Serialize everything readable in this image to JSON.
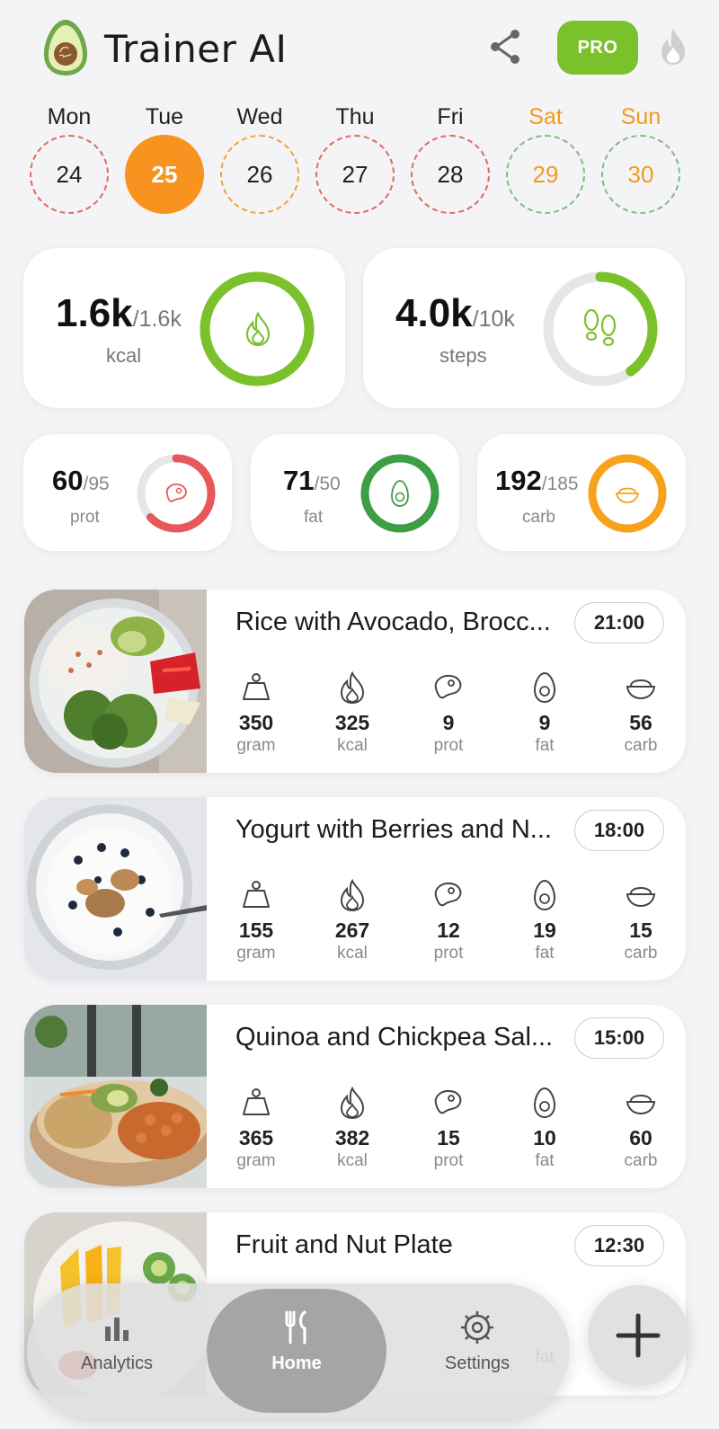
{
  "header": {
    "title": "Trainer AI",
    "pro_label": "PRO"
  },
  "days": [
    {
      "name": "Mon",
      "num": "24",
      "ring": "red"
    },
    {
      "name": "Tue",
      "num": "25",
      "ring": "active"
    },
    {
      "name": "Wed",
      "num": "26",
      "ring": "orange"
    },
    {
      "name": "Thu",
      "num": "27",
      "ring": "red"
    },
    {
      "name": "Fri",
      "num": "28",
      "ring": "red"
    },
    {
      "name": "Sat",
      "num": "29",
      "ring": "green"
    },
    {
      "name": "Sun",
      "num": "30",
      "ring": "green"
    }
  ],
  "summary": {
    "calories": {
      "value": "1.6k",
      "goal": "/1.6k",
      "unit": "kcal",
      "progress": 1.0,
      "color": "#7bc12b"
    },
    "steps": {
      "value": "4.0k",
      "goal": "/10k",
      "unit": "steps",
      "progress": 0.4,
      "color": "#7bc12b"
    }
  },
  "macros": {
    "protein": {
      "value": "60",
      "goal": "/95",
      "unit": "prot",
      "progress": 0.63,
      "color": "#e8575a"
    },
    "fat": {
      "value": "71",
      "goal": "/50",
      "unit": "fat",
      "progress": 1.0,
      "color": "#3d9e44"
    },
    "carb": {
      "value": "192",
      "goal": "/185",
      "unit": "carb",
      "progress": 1.0,
      "color": "#f7a21c"
    }
  },
  "meal_labels": {
    "gram": "gram",
    "kcal": "kcal",
    "prot": "prot",
    "fat": "fat",
    "carb": "carb"
  },
  "meals": [
    {
      "name": "Rice with Avocado, Brocc...",
      "time": "21:00",
      "gram": "350",
      "kcal": "325",
      "prot": "9",
      "fat": "9",
      "carb": "56"
    },
    {
      "name": "Yogurt with Berries and N...",
      "time": "18:00",
      "gram": "155",
      "kcal": "267",
      "prot": "12",
      "fat": "19",
      "carb": "15"
    },
    {
      "name": "Quinoa and Chickpea Sal...",
      "time": "15:00",
      "gram": "365",
      "kcal": "382",
      "prot": "15",
      "fat": "10",
      "carb": "60"
    },
    {
      "name": "Fruit and Nut Plate",
      "time": "12:30",
      "gram": "",
      "kcal": "",
      "prot": "",
      "fat": "fat",
      "carb": ""
    }
  ],
  "nav": {
    "analytics": "Analytics",
    "home": "Home",
    "settings": "Settings"
  },
  "colors": {
    "accent_green": "#7bc12b",
    "today_orange": "#f7931e",
    "weekend_orange": "#f39a1c"
  }
}
